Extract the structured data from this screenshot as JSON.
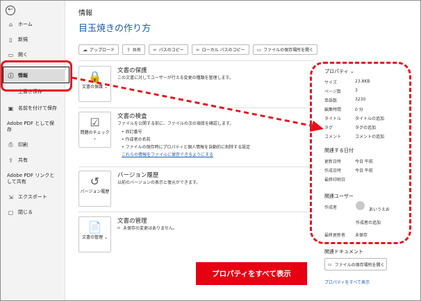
{
  "sidebar": {
    "back_icon": "arrow-left-circle-icon",
    "items": [
      {
        "label": "ホーム",
        "icon": "home-icon"
      },
      {
        "label": "新規",
        "icon": "new-doc-icon"
      },
      {
        "label": "開く",
        "icon": "folder-icon"
      },
      {
        "label": "情報",
        "icon": "info-icon"
      },
      {
        "label": "上書き保存",
        "icon": "save-icon"
      },
      {
        "label": "名前を付けて保存",
        "icon": "save-as-icon"
      },
      {
        "label": "Adobe PDF として保存",
        "icon": ""
      },
      {
        "label": "印刷",
        "icon": "print-icon"
      },
      {
        "label": "共有",
        "icon": "share-icon"
      },
      {
        "label": "Adobe PDF リンクとして共有",
        "icon": ""
      },
      {
        "label": "エクスポート",
        "icon": "export-icon"
      },
      {
        "label": "閉じる",
        "icon": "close-icon"
      }
    ]
  },
  "main": {
    "page_title": "情報",
    "doc_title": "目玉焼きの作り方",
    "toolbar": [
      "アップロード",
      "共有",
      "パスのコピー",
      "ローカル パスのコピー",
      "ファイルの保存場所を開く"
    ],
    "protect": {
      "button": "文書の保護",
      "title": "文書の保護",
      "desc": "この文書に対してユーザーが行える変更の種類を管理します。"
    },
    "inspect": {
      "button": "問題のチェック",
      "title": "文書の検査",
      "desc": "ファイルを公開する前に、ファイルの次の項目を確認します。",
      "bullets": [
        "改訂番号",
        "作成者の名前",
        "ファイルの保存時にプロパティと個人情報を自動的に削除する設定"
      ],
      "link": "これらの情報をファイルに保存できるようにする"
    },
    "versions": {
      "button": "バージョン履歴",
      "title": "バージョン履歴",
      "desc": "以前のバージョンの表示と復元ができます。"
    },
    "manage": {
      "button": "文書の管理",
      "title": "文書の管理",
      "desc": "未保存の変更はありません。"
    }
  },
  "properties": {
    "header": "プロパティ",
    "rows": [
      {
        "k": "サイズ",
        "v": "23.8KB"
      },
      {
        "k": "ページ数",
        "v": "3"
      },
      {
        "k": "単語数",
        "v": "3230"
      },
      {
        "k": "編集時間",
        "v": "0 分"
      },
      {
        "k": "タイトル",
        "v": "タイトルの追加"
      },
      {
        "k": "タグ",
        "v": "タグの追加"
      },
      {
        "k": "コメント",
        "v": "コメントの追加"
      }
    ],
    "dates_header": "関連する日付",
    "dates": [
      {
        "k": "更新日時",
        "v": "今日 午前"
      },
      {
        "k": "作成日時",
        "v": "今日 午前"
      },
      {
        "k": "最終印刷日",
        "v": ""
      }
    ],
    "users_header": "関連ユーザー",
    "author_label": "作成者",
    "author_name": "あいうえお",
    "add_author": "作成者の追加",
    "last_modified_label": "最終更新者",
    "last_modified_value": "未保存",
    "docs_header": "関連ドキュメント",
    "open_location": "ファイルの保存場所を開く",
    "show_all": "プロパティをすべて表示"
  },
  "annotation": {
    "banner": "プロパティをすべて表示",
    "accent_color": "#e8111c"
  }
}
